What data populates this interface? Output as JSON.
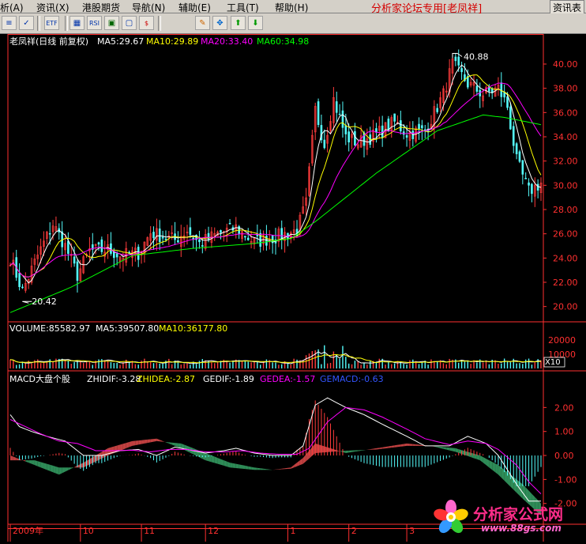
{
  "menu": {
    "items": [
      "析(A)",
      "资讯(X)",
      "港股期货",
      "导航(N)",
      "辅助(E)",
      "工具(T)",
      "帮助(H)"
    ],
    "banner": "分析家论坛专用[老凤祥]",
    "right_button": "资讯表"
  },
  "toolbar": {
    "buttons": [
      "lines-icon",
      "tick-icon",
      "f10-icon",
      "grid-icon",
      "rsi-icon",
      "screen-icon",
      "window-icon",
      "dollar-icon",
      "pencil-icon",
      "move-icon",
      "up-arrow-icon",
      "down-arrow-icon"
    ],
    "labels": [
      "",
      "",
      "ETF",
      "",
      "RSI",
      "",
      "",
      "$",
      "",
      "",
      "",
      ""
    ]
  },
  "colors": {
    "price_axis": "#ff3030",
    "ma5": "#ffffff",
    "ma10": "#ffff00",
    "ma20": "#ff00ff",
    "ma60": "#00ff00",
    "up_bar": "#ff3c3c",
    "down_bar": "#54fcfc",
    "hist_pos": "#c04040",
    "hist_neg": "#2e8b57"
  },
  "price_panel": {
    "title": "老凤祥(日线 前复权)",
    "ma5_label": "MA5:29.67",
    "ma10_label": "MA10:29.89",
    "ma20_label": "MA20:33.40",
    "ma60_label": "MA60:34.98",
    "high_annotation": "40.88",
    "low_annotation": "20.42"
  },
  "volume_panel": {
    "volume_label": "VOLUME:85582.97",
    "ma5_label": "MA5:39507.80",
    "ma10_label": "MA10:36177.80",
    "unit_label": "X10"
  },
  "macd_panel": {
    "title": "MACD大盘个股",
    "zhidif_label": "ZHIDIF:-3.28",
    "zhidea_label": "ZHIDEA:-2.87",
    "gedif_label": "GEDIF:-1.89",
    "gedea_label": "GEDEA:-1.57",
    "gemacd_label": "GEMACD:-0.63"
  },
  "x_axis": {
    "labels": [
      "2009年",
      "10",
      "11",
      "12",
      "1",
      "2",
      "3"
    ],
    "positions": [
      0,
      23,
      43,
      64,
      91,
      111,
      130
    ]
  },
  "logo": {
    "name": "分析家公式网",
    "url": "www.88gs.com"
  },
  "chart_data": {
    "type": "candlestick",
    "price": {
      "ylim": [
        19,
        41.5
      ],
      "ticks": [
        20,
        22,
        24,
        26,
        28,
        30,
        32,
        34,
        36,
        38,
        40
      ],
      "bars": 175,
      "anchors": [
        [
          0,
          24.0
        ],
        [
          4,
          21.3
        ],
        [
          9,
          24.2
        ],
        [
          14,
          26.8
        ],
        [
          18,
          25.0
        ],
        [
          22,
          22.6
        ],
        [
          26,
          24.6
        ],
        [
          32,
          24.7
        ],
        [
          36,
          24.2
        ],
        [
          42,
          24.4
        ],
        [
          46,
          26.1
        ],
        [
          54,
          25.5
        ],
        [
          58,
          26.3
        ],
        [
          62,
          25.2
        ],
        [
          68,
          26.0
        ],
        [
          74,
          26.5
        ],
        [
          80,
          25.3
        ],
        [
          88,
          25.8
        ],
        [
          94,
          26.3
        ],
        [
          97,
          28.5
        ],
        [
          100,
          36.2
        ],
        [
          103,
          33.4
        ],
        [
          106,
          37.1
        ],
        [
          110,
          34.0
        ],
        [
          114,
          33.5
        ],
        [
          120,
          34.2
        ],
        [
          126,
          35.2
        ],
        [
          130,
          34.3
        ],
        [
          136,
          34.5
        ],
        [
          142,
          37.5
        ],
        [
          145,
          40.0
        ],
        [
          150,
          38.4
        ],
        [
          155,
          37.5
        ],
        [
          160,
          38.0
        ],
        [
          163,
          36.5
        ],
        [
          166,
          32.0
        ],
        [
          170,
          29.5
        ],
        [
          174,
          30.2
        ]
      ],
      "ma60_anchors": [
        [
          0,
          19.5
        ],
        [
          20,
          21.6
        ],
        [
          40,
          24.2
        ],
        [
          60,
          24.8
        ],
        [
          80,
          25.2
        ],
        [
          92,
          25.6
        ],
        [
          100,
          27.0
        ],
        [
          120,
          31.0
        ],
        [
          140,
          34.5
        ],
        [
          155,
          35.8
        ],
        [
          162,
          35.6
        ],
        [
          174,
          35.0
        ]
      ]
    },
    "volume": {
      "ylim": [
        0,
        25000
      ],
      "ticks": [
        10000,
        20000
      ]
    },
    "macd": {
      "ylim": [
        -2.8,
        3.0
      ],
      "ticks": [
        -2.0,
        -1.0,
        0.0,
        1.0,
        2.0
      ],
      "zhidif_anchors": [
        [
          0,
          0.0
        ],
        [
          8,
          -0.4
        ],
        [
          16,
          -0.8
        ],
        [
          24,
          -0.3
        ],
        [
          32,
          0.3
        ],
        [
          40,
          0.6
        ],
        [
          48,
          0.7
        ],
        [
          56,
          0.3
        ],
        [
          64,
          -0.2
        ],
        [
          72,
          -0.5
        ],
        [
          80,
          -0.6
        ],
        [
          86,
          -0.6
        ],
        [
          92,
          -0.5
        ],
        [
          96,
          -0.1
        ],
        [
          100,
          0.5
        ],
        [
          110,
          0.1
        ],
        [
          120,
          0.3
        ],
        [
          130,
          0.5
        ],
        [
          138,
          0.4
        ],
        [
          146,
          0.15
        ],
        [
          154,
          -0.2
        ],
        [
          160,
          -0.8
        ],
        [
          168,
          -1.8
        ],
        [
          174,
          -2.5
        ]
      ],
      "zhidea_anchors": [
        [
          0,
          -0.2
        ],
        [
          8,
          -0.2
        ],
        [
          16,
          -0.5
        ],
        [
          24,
          -0.5
        ],
        [
          32,
          0.0
        ],
        [
          40,
          0.4
        ],
        [
          48,
          0.6
        ],
        [
          56,
          0.5
        ],
        [
          64,
          0.1
        ],
        [
          72,
          -0.3
        ],
        [
          80,
          -0.5
        ],
        [
          86,
          -0.6
        ],
        [
          92,
          -0.55
        ],
        [
          96,
          -0.35
        ],
        [
          100,
          0.1
        ],
        [
          110,
          0.2
        ],
        [
          120,
          0.25
        ],
        [
          130,
          0.4
        ],
        [
          138,
          0.4
        ],
        [
          146,
          0.3
        ],
        [
          154,
          0.0
        ],
        [
          160,
          -0.4
        ],
        [
          168,
          -1.2
        ],
        [
          174,
          -2.0
        ]
      ],
      "gedif_anchors": [
        [
          0,
          1.7
        ],
        [
          3,
          1.2
        ],
        [
          7,
          1.0
        ],
        [
          12,
          0.8
        ],
        [
          18,
          0.6
        ],
        [
          24,
          0.0
        ],
        [
          30,
          0.0
        ],
        [
          36,
          0.2
        ],
        [
          42,
          0.25
        ],
        [
          48,
          0.0
        ],
        [
          54,
          0.35
        ],
        [
          60,
          0.2
        ],
        [
          64,
          0.1
        ],
        [
          70,
          0.2
        ],
        [
          74,
          0.3
        ],
        [
          80,
          0.1
        ],
        [
          86,
          0.0
        ],
        [
          92,
          0.0
        ],
        [
          96,
          0.4
        ],
        [
          100,
          2.1
        ],
        [
          104,
          2.4
        ],
        [
          110,
          2.0
        ],
        [
          116,
          1.7
        ],
        [
          122,
          1.3
        ],
        [
          130,
          0.8
        ],
        [
          136,
          0.4
        ],
        [
          144,
          0.4
        ],
        [
          150,
          0.8
        ],
        [
          156,
          0.5
        ],
        [
          160,
          0.0
        ],
        [
          166,
          -1.2
        ],
        [
          170,
          -1.9
        ],
        [
          174,
          -1.9
        ]
      ],
      "gedea_anchors": [
        [
          0,
          1.5
        ],
        [
          5,
          1.2
        ],
        [
          10,
          0.9
        ],
        [
          16,
          0.6
        ],
        [
          22,
          0.5
        ],
        [
          28,
          0.2
        ],
        [
          34,
          0.2
        ],
        [
          40,
          0.22
        ],
        [
          46,
          0.15
        ],
        [
          52,
          0.25
        ],
        [
          58,
          0.25
        ],
        [
          64,
          0.15
        ],
        [
          70,
          0.15
        ],
        [
          76,
          0.2
        ],
        [
          82,
          0.1
        ],
        [
          88,
          0.05
        ],
        [
          94,
          0.05
        ],
        [
          98,
          0.3
        ],
        [
          104,
          1.4
        ],
        [
          110,
          2.0
        ],
        [
          116,
          1.9
        ],
        [
          122,
          1.6
        ],
        [
          130,
          1.1
        ],
        [
          136,
          0.7
        ],
        [
          144,
          0.45
        ],
        [
          150,
          0.6
        ],
        [
          156,
          0.5
        ],
        [
          160,
          0.25
        ],
        [
          166,
          -0.4
        ],
        [
          170,
          -1.1
        ],
        [
          174,
          -1.6
        ]
      ]
    }
  }
}
